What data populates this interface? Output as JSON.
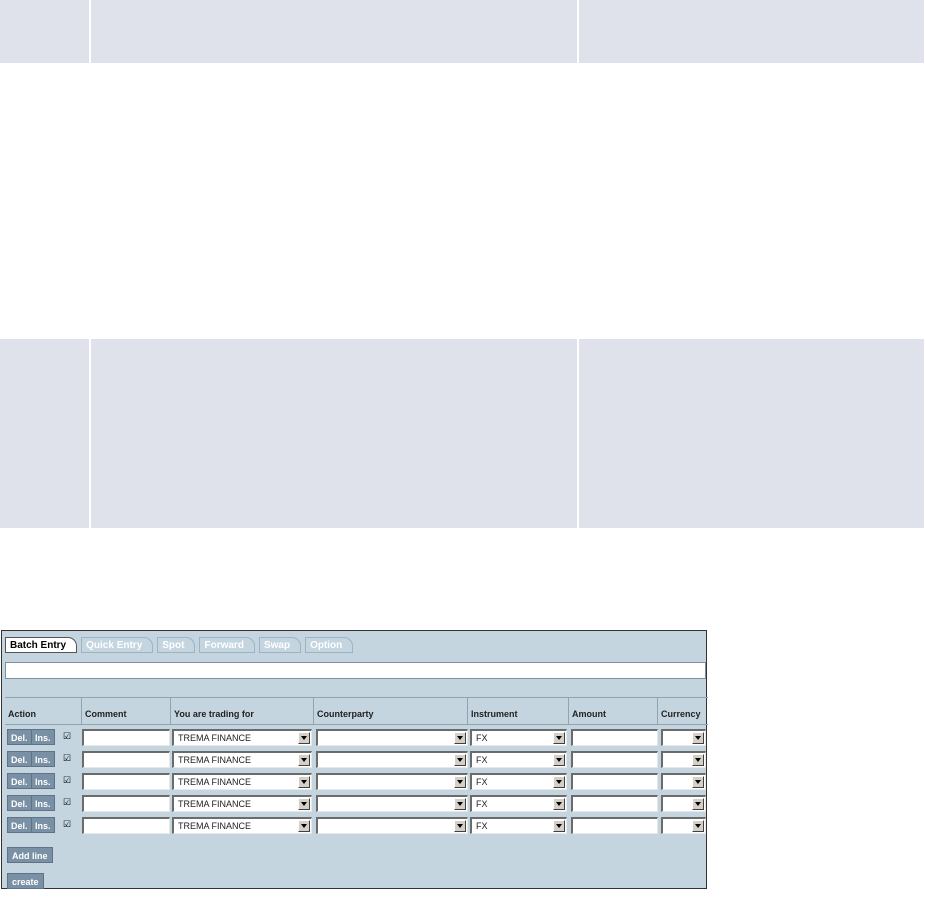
{
  "tabs": [
    "Batch Entry",
    "Quick Entry",
    "Spot",
    "Forward",
    "Swap",
    "Option"
  ],
  "columns": [
    "Action",
    "Comment",
    "You are trading for",
    "Counterparty",
    "Instrument",
    "Amount",
    "Currency"
  ],
  "row_buttons": {
    "delete": "Del.",
    "insert": "Ins."
  },
  "checkbox_mark": "☑",
  "rows": [
    {
      "trading_for": "TREMA FINANCE",
      "instrument": "FX"
    },
    {
      "trading_for": "TREMA FINANCE",
      "instrument": "FX"
    },
    {
      "trading_for": "TREMA FINANCE",
      "instrument": "FX"
    },
    {
      "trading_for": "TREMA FINANCE",
      "instrument": "FX"
    },
    {
      "trading_for": "TREMA FINANCE",
      "instrument": "FX"
    }
  ],
  "buttons": {
    "add_line": "Add line",
    "create": "create"
  },
  "colors": {
    "panel": "#c4d5e0",
    "button": "#7a91a5",
    "doc_cell": "#dfe2ea"
  }
}
